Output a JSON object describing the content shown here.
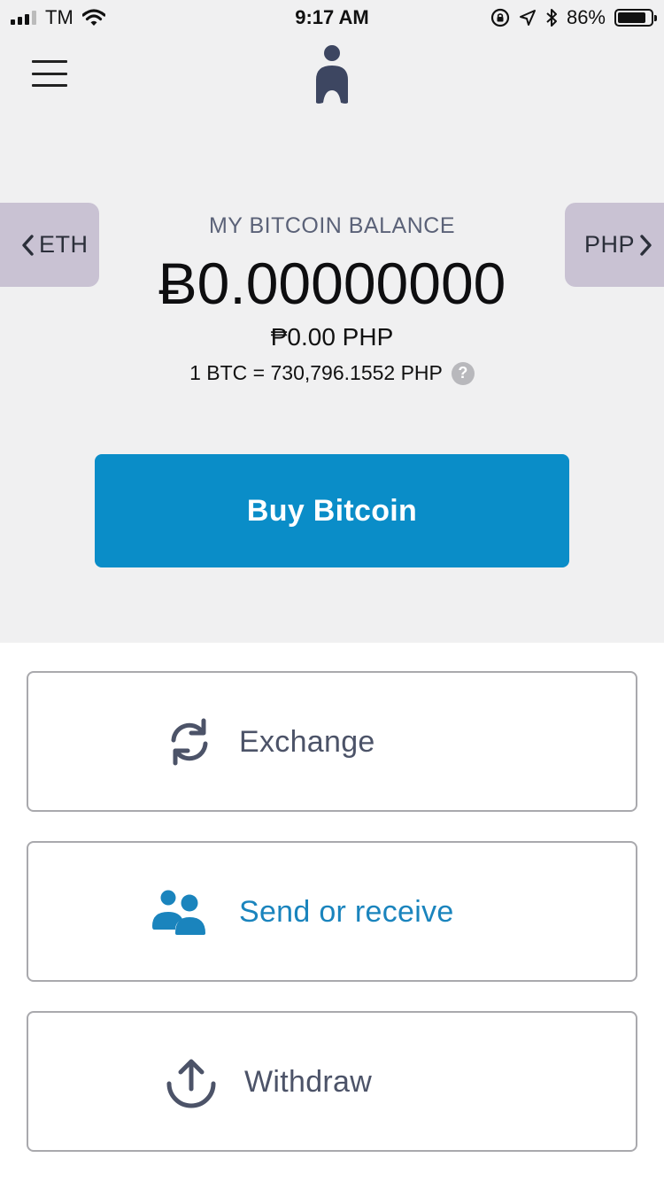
{
  "status_bar": {
    "carrier": "TM",
    "time": "9:17 AM",
    "battery": "86%",
    "icons": [
      "signal-icon",
      "wifi-icon",
      "orientation-lock-icon",
      "location-icon",
      "bluetooth-icon",
      "battery-icon"
    ]
  },
  "header": {
    "menu_icon": "hamburger-menu-icon",
    "logo_icon": "app-logo-icon"
  },
  "currency_tabs": {
    "prev_label": "ETH",
    "next_label": "PHP"
  },
  "balance": {
    "title": "MY BITCOIN BALANCE",
    "amount": "Ƀ0.00000000",
    "fiat": "₱0.00 PHP",
    "rate": "1 BTC = 730,796.1552 PHP",
    "help_glyph": "?"
  },
  "buy_button": {
    "label": "Buy Bitcoin",
    "color": "#0a8dc8"
  },
  "actions": [
    {
      "label": "Exchange",
      "icon": "exchange-icon",
      "color": "#4c5368"
    },
    {
      "label": "Send or receive",
      "icon": "users-icon",
      "color": "#1a84bd"
    },
    {
      "label": "Withdraw",
      "icon": "upload-icon",
      "color": "#4c5368"
    }
  ],
  "colors": {
    "background_top": "#f0f0f1",
    "side_tab": "#c9c2d3",
    "accent": "#0a8dc8"
  }
}
